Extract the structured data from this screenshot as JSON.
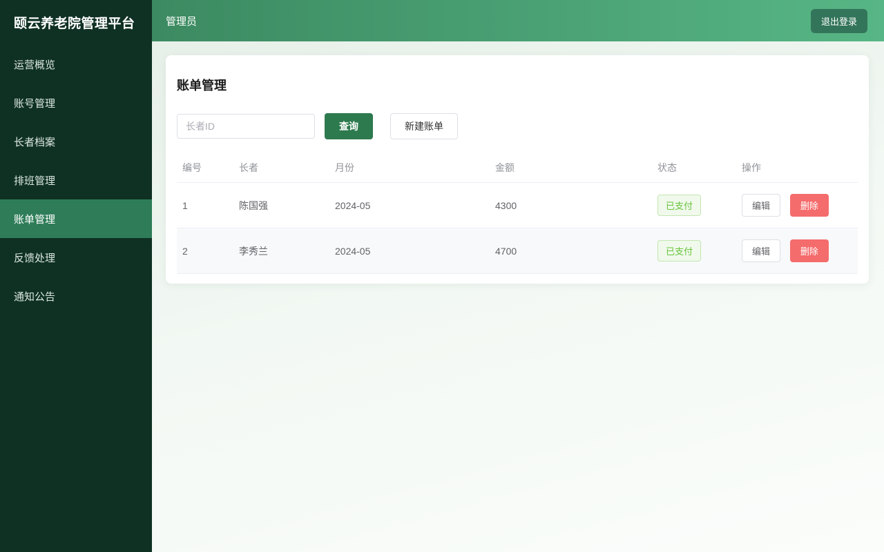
{
  "app": {
    "title": "颐云养老院管理平台"
  },
  "sidebar": {
    "items": [
      {
        "label": "运营概览"
      },
      {
        "label": "账号管理"
      },
      {
        "label": "长者档案"
      },
      {
        "label": "排班管理"
      },
      {
        "label": "账单管理"
      },
      {
        "label": "反馈处理"
      },
      {
        "label": "通知公告"
      }
    ],
    "active_label": "账单管理"
  },
  "header": {
    "user": "管理员",
    "logout_label": "退出登录"
  },
  "page": {
    "title": "账单管理"
  },
  "toolbar": {
    "search_placeholder": "长者ID",
    "search_button_label": "查询",
    "create_button_label": "新建账单"
  },
  "table": {
    "headers": [
      "编号",
      "长者",
      "月份",
      "金额",
      "状态",
      "操作"
    ],
    "rows": [
      {
        "id": "1",
        "elder": "陈国强",
        "month": "2024-05",
        "amount": "4300",
        "status": "已支付",
        "edit_label": "编辑",
        "delete_label": "删除"
      },
      {
        "id": "2",
        "elder": "李秀兰",
        "month": "2024-05",
        "amount": "4700",
        "status": "已支付",
        "edit_label": "编辑",
        "delete_label": "删除"
      }
    ]
  },
  "colors": {
    "sidebar_bg": "#0f3123",
    "sidebar_active_bg": "#2e7d58",
    "header_gradient_start": "#3c8a61",
    "header_gradient_end": "#57b685",
    "primary_button": "#2d7a4e",
    "delete_button": "#f56c6c",
    "status_paid_text": "#67c23a",
    "status_paid_bg": "#f0f9eb"
  }
}
